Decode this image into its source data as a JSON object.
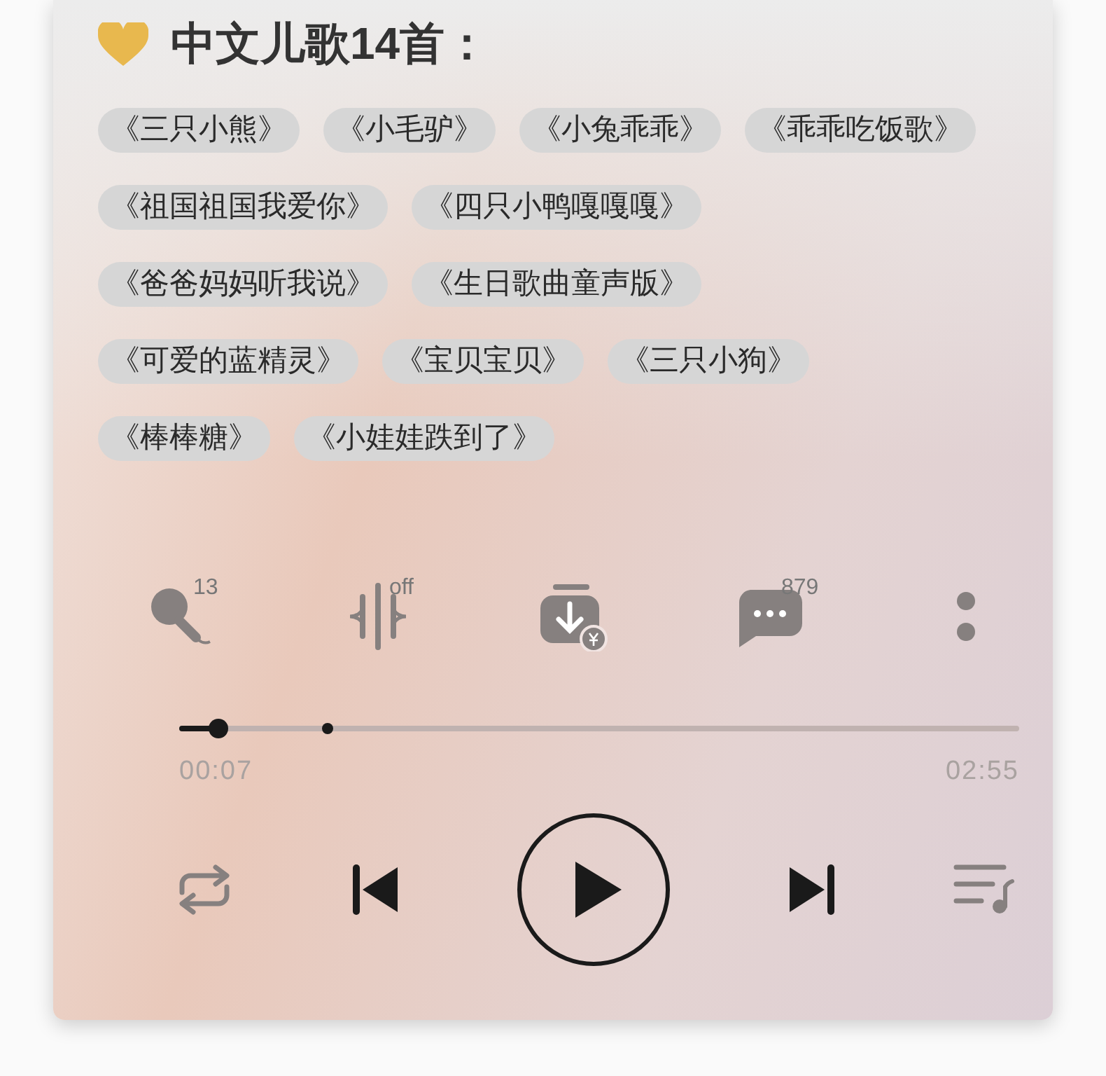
{
  "heading": {
    "title": "中文儿歌14首："
  },
  "song_rows": [
    [
      "《三只小熊》",
      "《小毛驴》",
      "《小兔乖乖》",
      "《乖乖吃饭歌》"
    ],
    [
      "《祖国祖国我爱你》",
      "《四只小鸭嘎嘎嘎》"
    ],
    [
      "《爸爸妈妈听我说》",
      "《生日歌曲童声版》"
    ],
    [
      "《可爱的蓝精灵》",
      "《宝贝宝贝》",
      "《三只小狗》"
    ],
    [
      "《棒棒糖》",
      "《小娃娃跌到了》"
    ]
  ],
  "actions": [
    {
      "kind": "karaoke",
      "badge": "13"
    },
    {
      "kind": "sound_effect",
      "badge": "off"
    },
    {
      "kind": "download"
    },
    {
      "kind": "comments",
      "badge": "879"
    },
    {
      "kind": "more"
    }
  ],
  "progress": {
    "level": 0.047,
    "marker": {
      "level": 0.177
    },
    "elapsed": "00:07",
    "total": "02:55"
  },
  "controls": [
    {
      "kind": "repeat"
    },
    {
      "kind": "previous"
    },
    {
      "kind": "play"
    },
    {
      "kind": "next"
    },
    {
      "kind": "playlist"
    }
  ]
}
